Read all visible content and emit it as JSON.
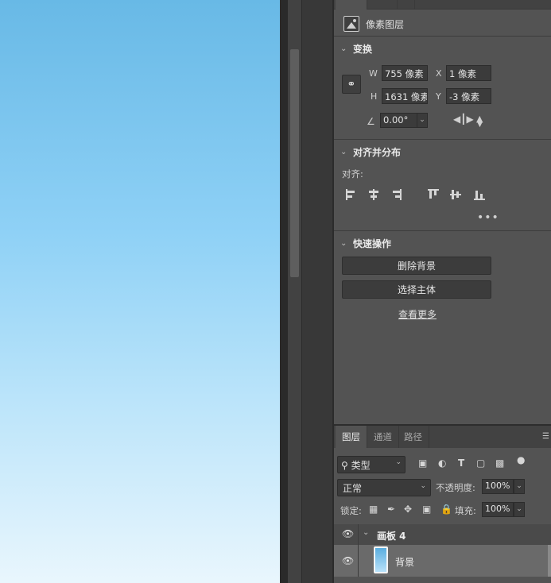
{
  "properties": {
    "layer_type": "像素图层",
    "transform": {
      "title": "变换",
      "w_label": "W",
      "w_value": "755 像素",
      "h_label": "H",
      "h_value": "1631 像素",
      "x_label": "X",
      "x_value": "1 像素",
      "y_label": "Y",
      "y_value": "-3 像素",
      "angle_value": "0.00°"
    },
    "align": {
      "title": "对齐并分布",
      "sub_label": "对齐:"
    },
    "quick_actions": {
      "title": "快速操作",
      "remove_bg": "删除背景",
      "select_subject": "选择主体",
      "see_more": "查看更多"
    }
  },
  "layers": {
    "tabs": [
      "图层",
      "通道",
      "路径"
    ],
    "filter_label": "类型",
    "blend_mode": "正常",
    "opacity_label": "不透明度:",
    "opacity_value": "100%",
    "lock_label": "锁定:",
    "fill_label": "填充:",
    "fill_value": "100%",
    "artboard_name": "画板 4",
    "background_name": "背景"
  },
  "colors": {
    "panel_bg": "#535353",
    "canvas_top": "#68b9e6",
    "canvas_bottom": "#e9f6fd"
  }
}
